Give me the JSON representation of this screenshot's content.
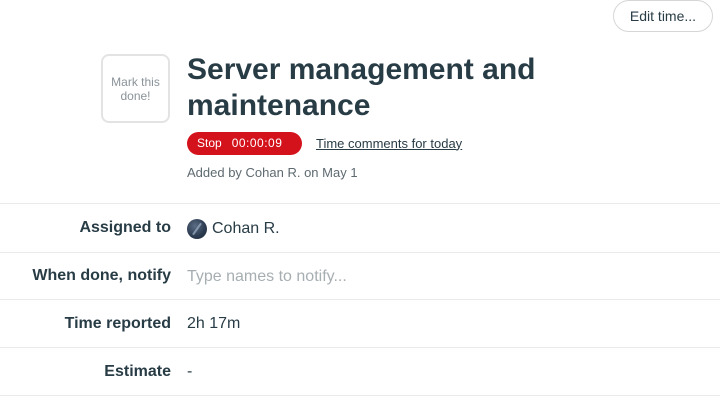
{
  "header": {
    "edit_time_label": "Edit time..."
  },
  "task": {
    "mark_done_label": "Mark this done!",
    "title": "Server management and maintenance",
    "timer": {
      "stop_label": "Stop",
      "elapsed": "00:00:09",
      "color": "#d4121c"
    },
    "time_comments_link": "Time comments for today",
    "added_by": "Added by Cohan R. on May 1"
  },
  "fields": {
    "assigned_to": {
      "label": "Assigned to",
      "value": "Cohan R.",
      "avatar_icon": "user-avatar"
    },
    "notify": {
      "label": "When done, notify",
      "value": "",
      "placeholder": "Type names to notify..."
    },
    "time_reported": {
      "label": "Time reported",
      "value": "2h 17m"
    },
    "estimate": {
      "label": "Estimate",
      "value": "-"
    }
  }
}
